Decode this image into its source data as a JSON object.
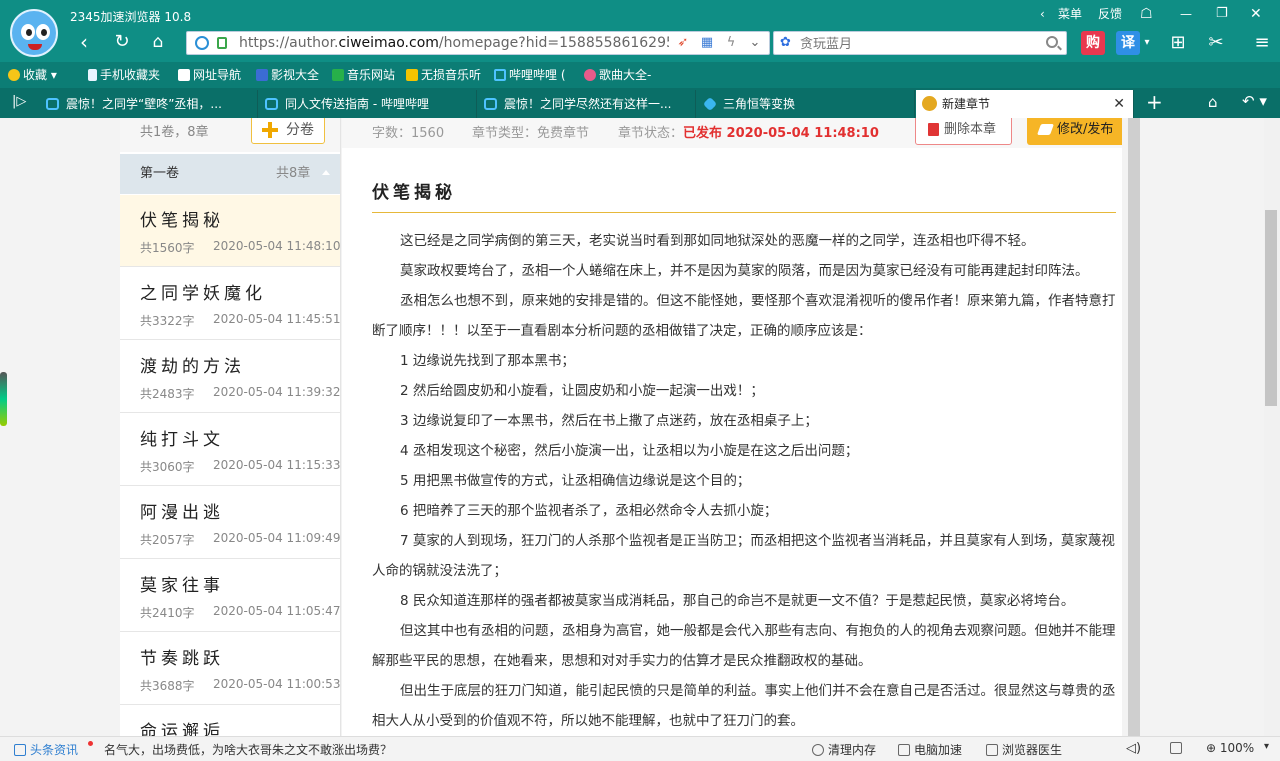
{
  "browser": {
    "title": "2345加速浏览器 10.8",
    "menu_label": "菜单",
    "feedback_label": "反馈",
    "url_prefix": "https://author.",
    "url_domain": "ciweimao.com",
    "url_path": "/homepage?hid=15885586162958",
    "search_placeholder": "贪玩蓝月",
    "btn_buy": "购",
    "btn_translate": "译"
  },
  "bookmarks": [
    {
      "label": "收藏",
      "icon": "star-icon"
    },
    {
      "label": "手机收藏夹",
      "icon": "phone-icon"
    },
    {
      "label": "网址导航",
      "icon": "page-icon"
    },
    {
      "label": "影视大全",
      "icon": "video-icon"
    },
    {
      "label": "音乐网站",
      "icon": "music-icon"
    },
    {
      "label": "无损音乐听",
      "icon": "lossless-icon"
    },
    {
      "label": "哔哩哔哩 (",
      "icon": "bilibili-icon"
    },
    {
      "label": "歌曲大全-",
      "icon": "song-icon"
    }
  ],
  "tabs": [
    {
      "label": "震惊！之同学“壁咚”丞相，..."
    },
    {
      "label": "同人文传送指南 - 哔哩哔哩"
    },
    {
      "label": "震惊！之同学尽然还有这样一..."
    },
    {
      "label": "三角恒等变换"
    },
    {
      "label": "新建章节"
    }
  ],
  "sidebar": {
    "summary": "共1卷，8章",
    "split_label": "分卷",
    "volume_name": "第一卷",
    "volume_chapters": "共8章",
    "chapters": [
      {
        "title": "伏笔揭秘",
        "words": "共1560字",
        "date": "2020-05-04 11:48:10"
      },
      {
        "title": "之同学妖魔化",
        "words": "共3322字",
        "date": "2020-05-04 11:45:51"
      },
      {
        "title": "渡劫的方法",
        "words": "共2483字",
        "date": "2020-05-04 11:39:32"
      },
      {
        "title": "纯打斗文",
        "words": "共3060字",
        "date": "2020-05-04 11:15:33"
      },
      {
        "title": "阿漫出逃",
        "words": "共2057字",
        "date": "2020-05-04 11:09:49"
      },
      {
        "title": "莫家往事",
        "words": "共2410字",
        "date": "2020-05-04 11:05:47"
      },
      {
        "title": "节奏跳跃",
        "words": "共3688字",
        "date": "2020-05-04 11:00:53"
      },
      {
        "title": "命运邂逅",
        "words": "",
        "date": ""
      }
    ]
  },
  "chapter": {
    "word_count": "字数：1560",
    "type": "章节类型：免费章节",
    "status_prefix": "章节状态：",
    "status_value": "已发布 2020-05-04 11:48:10",
    "delete_label": "删除本章",
    "publish_label": "修改/发布",
    "title": "伏笔揭秘",
    "paragraphs": [
      "这已经是之同学病倒的第三天，老实说当时看到那如同地狱深处的恶魔一样的之同学，连丞相也吓得不轻。",
      "莫家政权要垮台了，丞相一个人蜷缩在床上，并不是因为莫家的陨落，而是因为莫家已经没有可能再建起封印阵法。",
      "丞相怎么也想不到，原来她的安排是错的。但这不能怪她，要怪那个喜欢混淆视听的傻吊作者！原来第九篇，作者特意打断了顺序！！！以至于一直看剧本分析问题的丞相做错了决定，正确的顺序应该是：",
      "1 边缘说先找到了那本黑书；",
      "2 然后给圆皮奶和小旋看，让圆皮奶和小旋一起演一出戏！；",
      "3 边缘说复印了一本黑书，然后在书上撒了点迷药，放在丞相桌子上；",
      "4 丞相发现这个秘密，然后小旋演一出，让丞相以为小旋是在这之后出问题；",
      "5 用把黑书做宣传的方式，让丞相确信边缘说是这个目的；",
      "6 把暗养了三天的那个监视者杀了，丞相必然命令人去抓小旋；",
      "7 莫家的人到现场，狂刀门的人杀那个监视者是正当防卫；而丞相把这个监视者当消耗品，并且莫家有人到场，莫家蔑视人命的锅就没法洗了；",
      "8 民众知道连那样的强者都被莫家当成消耗品，那自己的命岂不是就更一文不值？于是惹起民愤，莫家必将垮台。",
      "但这其中也有丞相的问题，丞相身为高官，她一般都是会代入那些有志向、有抱负的人的视角去观察问题。但她并不能理解那些平民的思想，在她看来，思想和对对手实力的估算才是民众推翻政权的基础。",
      "但出生于底层的狂刀门知道，能引起民愤的只是简单的利益。事实上他们并不会在意自己是否活过。很显然这与尊贵的丞相大人从小受到的价值观不符，所以她不能理解，也就中了狂刀门的套。"
    ]
  },
  "statusbar": {
    "news_label": "头条资讯",
    "news_text": "名气大，出场费低，为啥大衣哥朱之文不敢涨出场费？",
    "clean_memory": "清理内存",
    "pc_speedup": "电脑加速",
    "browser_doctor": "浏览器医生",
    "zoom": "100%"
  },
  "colors": {
    "titlebar": "#0f8e85",
    "accent_yellow": "#f6b526",
    "published_red": "#e23030"
  }
}
